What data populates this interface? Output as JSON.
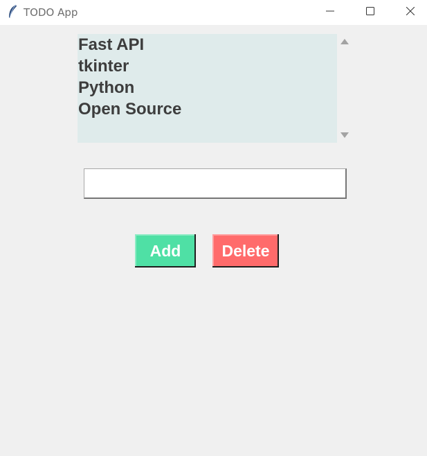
{
  "window": {
    "title": "TODO App"
  },
  "titlebar_controls": {
    "minimize_icon": "minimize-icon",
    "maximize_icon": "maximize-icon",
    "close_icon": "close-icon"
  },
  "todo_list": {
    "items": [
      "Fast API",
      "tkinter",
      "Python",
      "Open Source"
    ],
    "background": "#dfebeb"
  },
  "entry": {
    "value": "",
    "placeholder": ""
  },
  "buttons": {
    "add_label": "Add",
    "add_color": "#4fe0a5",
    "delete_label": "Delete",
    "delete_color": "#ff6b6b"
  }
}
